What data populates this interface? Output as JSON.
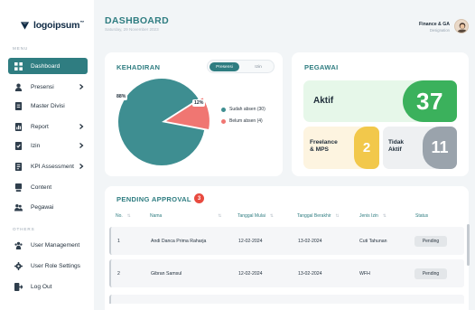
{
  "logo": {
    "text": "logoipsum",
    "mark": "™"
  },
  "sidebar": {
    "menu_heading": "MENU",
    "items": [
      {
        "label": "Dashboard",
        "icon": "dashboard-icon",
        "active": true,
        "chevron": false
      },
      {
        "label": "Presensi",
        "icon": "person-icon",
        "active": false,
        "chevron": true
      },
      {
        "label": "Master Divisi",
        "icon": "document-icon",
        "active": false,
        "chevron": false
      },
      {
        "label": "Report",
        "icon": "report-icon",
        "active": false,
        "chevron": true
      },
      {
        "label": "Izin",
        "icon": "permit-icon",
        "active": false,
        "chevron": true
      },
      {
        "label": "KPI Assessment",
        "icon": "kpi-icon",
        "active": false,
        "chevron": true
      },
      {
        "label": "Content",
        "icon": "content-icon",
        "active": false,
        "chevron": false
      },
      {
        "label": "Pegawai",
        "icon": "employees-icon",
        "active": false,
        "chevron": false
      }
    ],
    "others_heading": "OTHERS",
    "others": [
      {
        "label": "User Management",
        "icon": "users-icon"
      },
      {
        "label": "User Role Settings",
        "icon": "gear-icon"
      },
      {
        "label": "Log Out",
        "icon": "logout-icon"
      }
    ]
  },
  "header": {
    "title": "DASHBOARD",
    "subtitle": "Saturday, 29 November 2023",
    "user_name": "Finance & GA",
    "user_role": "Designation"
  },
  "kehadiran": {
    "title": "KEHADIRAN",
    "tabs": [
      "Presensi",
      "Izin"
    ],
    "active_tab": "Presensi"
  },
  "chart_data": {
    "type": "pie",
    "slices": [
      {
        "label": "Sudah absen (30)",
        "value": 88,
        "color": "#3e8e91"
      },
      {
        "label": "Belum absen (4)",
        "value": 12,
        "color": "#f07672"
      }
    ],
    "data_labels": [
      "88%",
      "12%"
    ],
    "legend_placement": "right"
  },
  "pegawai": {
    "title": "PEGAWAI",
    "aktif_label": "Aktif",
    "aktif_count": "37",
    "freelance_label_1": "Freelance",
    "freelance_label_2": "& MPS",
    "freelance_count": "2",
    "tidak_label_1": "Tidak",
    "tidak_label_2": "Aktif",
    "tidak_count": "11"
  },
  "pending": {
    "title": "PENDING APPROVAL",
    "count": "3",
    "columns": [
      "No.",
      "Nama",
      "Tanggal Mulai",
      "Tanggal Berakhir",
      "Jenis Izin",
      "Status"
    ],
    "rows": [
      {
        "no": "1",
        "nama": "Andi Danca Prima Raharja",
        "mulai": "12-02-2024",
        "akhir": "13-02-2024",
        "jenis": "Cuti Tahunan",
        "status": "Pending"
      },
      {
        "no": "2",
        "nama": "Gibran Samsul",
        "mulai": "12-02-2024",
        "akhir": "13-02-2024",
        "jenis": "WFH",
        "status": "Pending"
      }
    ]
  },
  "colors": {
    "primary": "#2f7d81",
    "aktif": "#3bb15c",
    "freelance": "#f2c84b",
    "tidak_aktif": "#9aa3ac",
    "belum": "#f07672",
    "badge": "#e84a3f"
  }
}
